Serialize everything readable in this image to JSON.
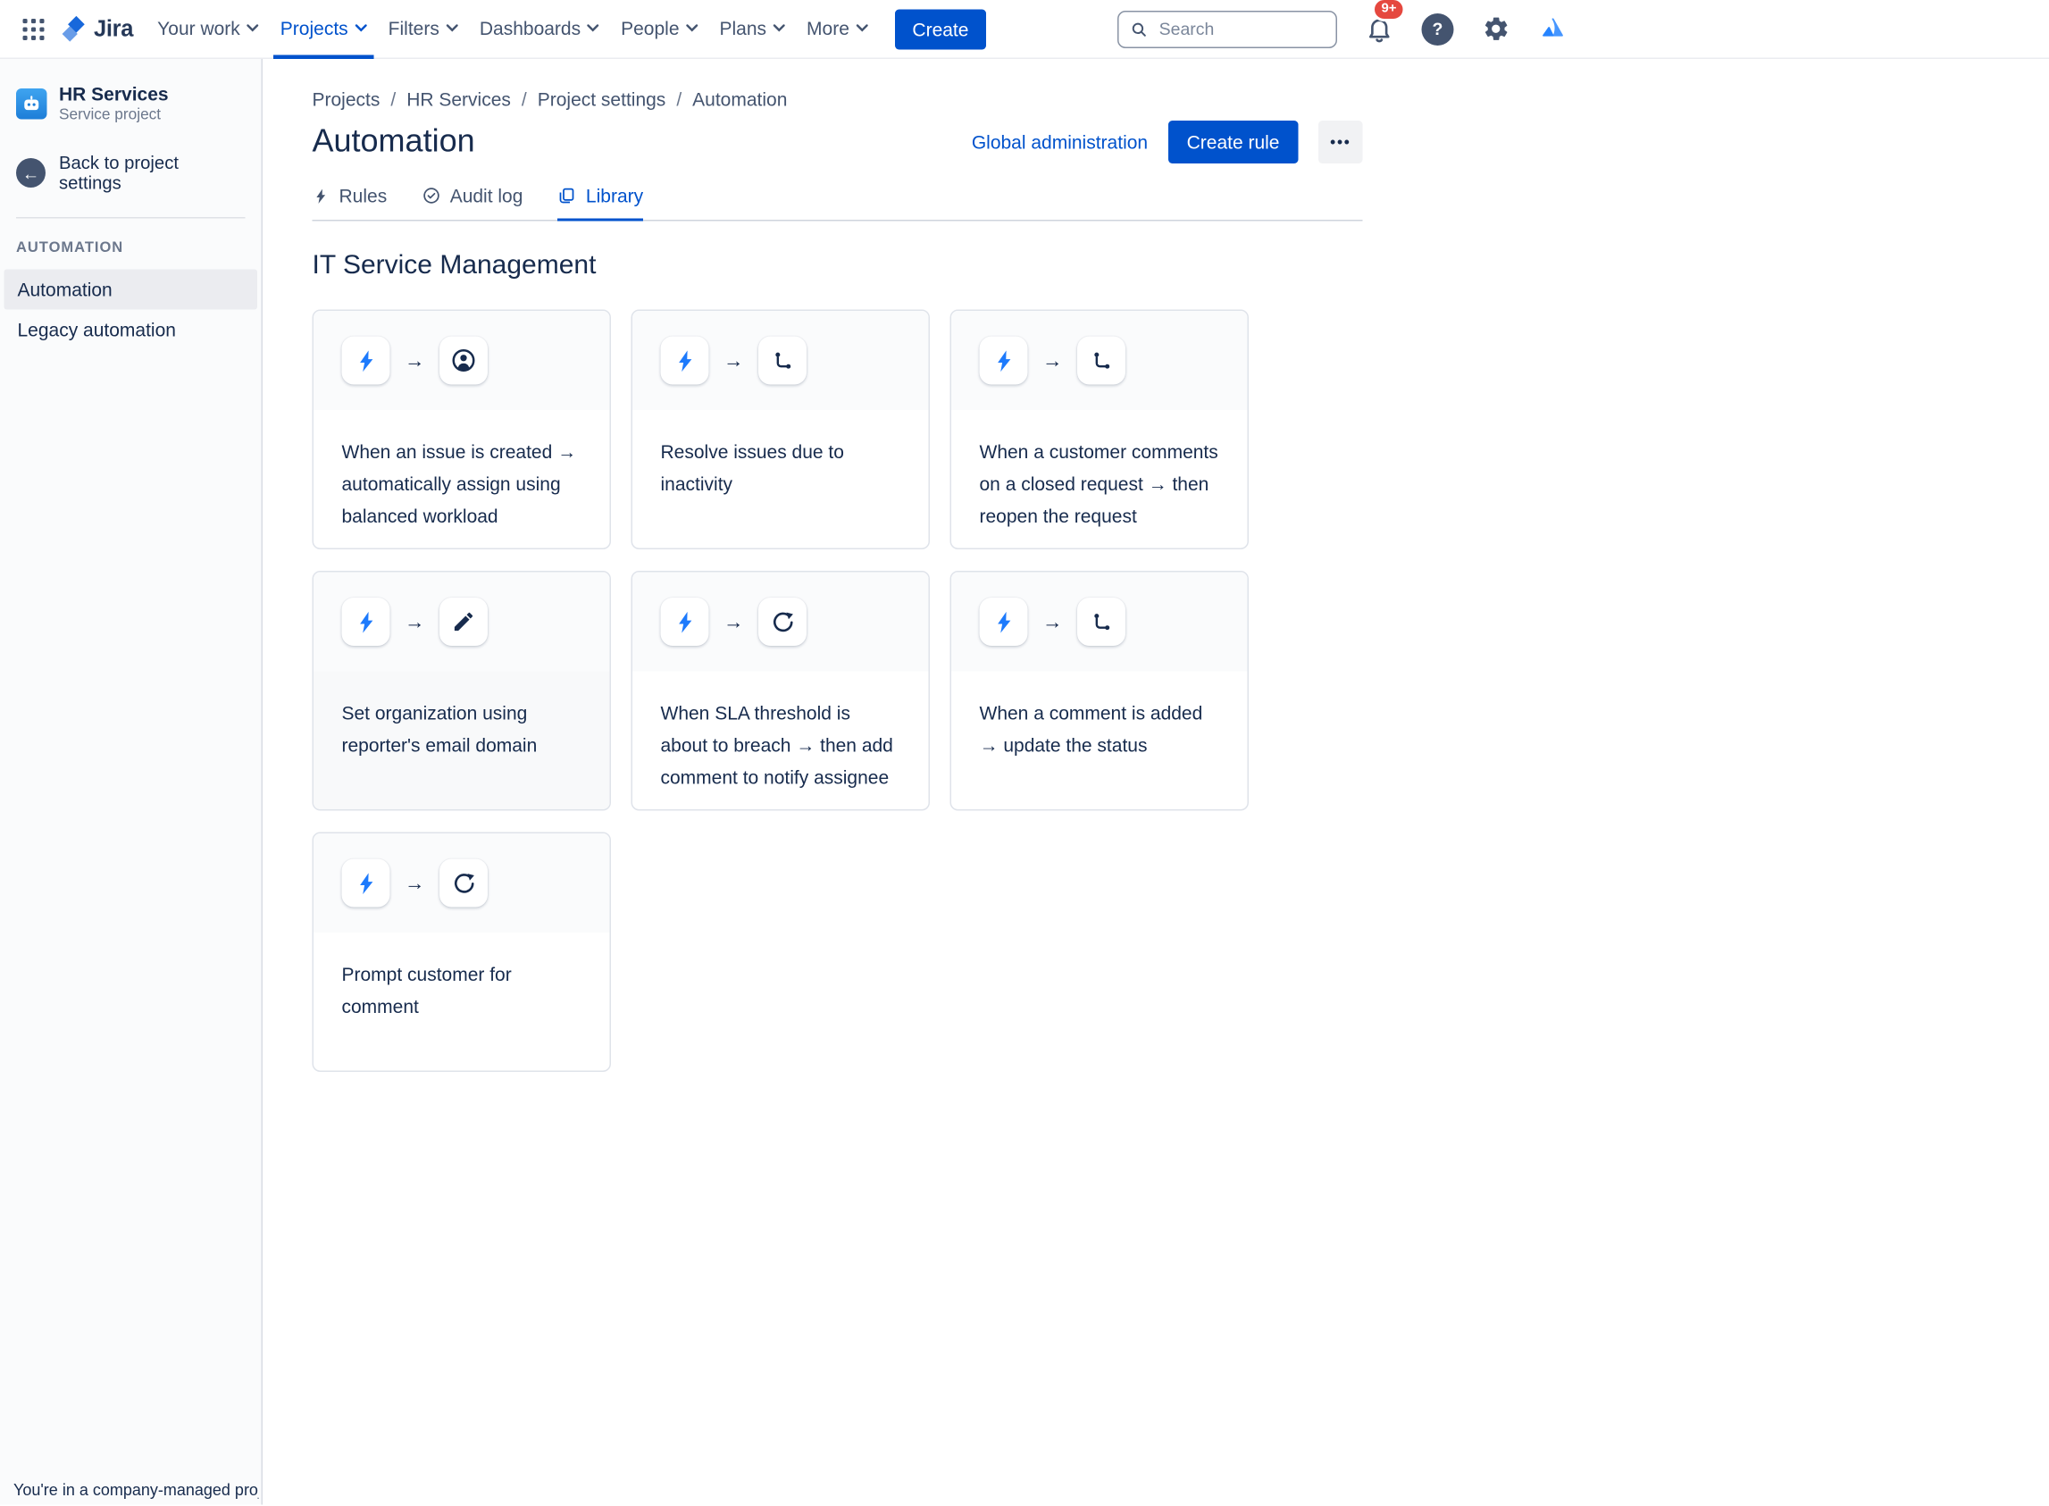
{
  "colors": {
    "brand": "#0052CC",
    "bolt": "#1D7AFC",
    "badge": "#E5483F",
    "ink": "#172B4D",
    "subtle": "#6B778C"
  },
  "top_nav": {
    "logo_text": "Jira",
    "items": [
      {
        "label": "Your work",
        "active": false
      },
      {
        "label": "Projects",
        "active": true
      },
      {
        "label": "Filters",
        "active": false
      },
      {
        "label": "Dashboards",
        "active": false
      },
      {
        "label": "People",
        "active": false
      },
      {
        "label": "Plans",
        "active": false
      },
      {
        "label": "More",
        "active": false
      }
    ],
    "create_label": "Create",
    "search_placeholder": "Search",
    "notification_count": "9+",
    "help_glyph": "?",
    "icon_names": [
      "app-switcher-icon",
      "jira-logo",
      "search-icon",
      "notification-bell-icon",
      "help-icon",
      "settings-gear-icon",
      "atlassian-logo"
    ]
  },
  "sidebar": {
    "project_name": "HR Services",
    "project_type": "Service project",
    "back_label": "Back to project settings",
    "back_glyph": "←",
    "section_label": "AUTOMATION",
    "items": [
      {
        "label": "Automation",
        "selected": true
      },
      {
        "label": "Legacy automation",
        "selected": false
      }
    ],
    "footer_note": "You're in a company-managed project"
  },
  "main": {
    "breadcrumbs": [
      "Projects",
      "HR Services",
      "Project settings",
      "Automation"
    ],
    "breadcrumb_separator": "/",
    "page_title": "Automation",
    "global_admin_label": "Global administration",
    "create_rule_label": "Create rule",
    "more_label": "•••",
    "tabs": [
      {
        "label": "Rules",
        "icon": "lightning-icon",
        "active": false
      },
      {
        "label": "Audit log",
        "icon": "audit-check-icon",
        "active": false
      },
      {
        "label": "Library",
        "icon": "library-pages-icon",
        "active": true
      }
    ],
    "section_title": "IT Service Management",
    "arrow_glyph": "→",
    "cards": [
      {
        "trigger_icon": "lightning-icon",
        "action_icon": "assign-user-icon",
        "text": "When an issue is created → automatically assign using balanced workload"
      },
      {
        "trigger_icon": "lightning-icon",
        "action_icon": "transition-icon",
        "text": "Resolve issues due to inactivity"
      },
      {
        "trigger_icon": "lightning-icon",
        "action_icon": "transition-icon",
        "text": "When a customer comments on a closed request → then reopen the request"
      },
      {
        "trigger_icon": "lightning-icon",
        "action_icon": "edit-pencil-icon",
        "text": "Set organization using reporter's email domain"
      },
      {
        "trigger_icon": "lightning-icon",
        "action_icon": "retry-icon",
        "text": "When SLA threshold is about to breach → then add comment to notify assignee"
      },
      {
        "trigger_icon": "lightning-icon",
        "action_icon": "transition-icon",
        "text": "When a comment is added → update the status"
      },
      {
        "trigger_icon": "lightning-icon",
        "action_icon": "retry-icon",
        "text": "Prompt customer for comment"
      }
    ]
  }
}
